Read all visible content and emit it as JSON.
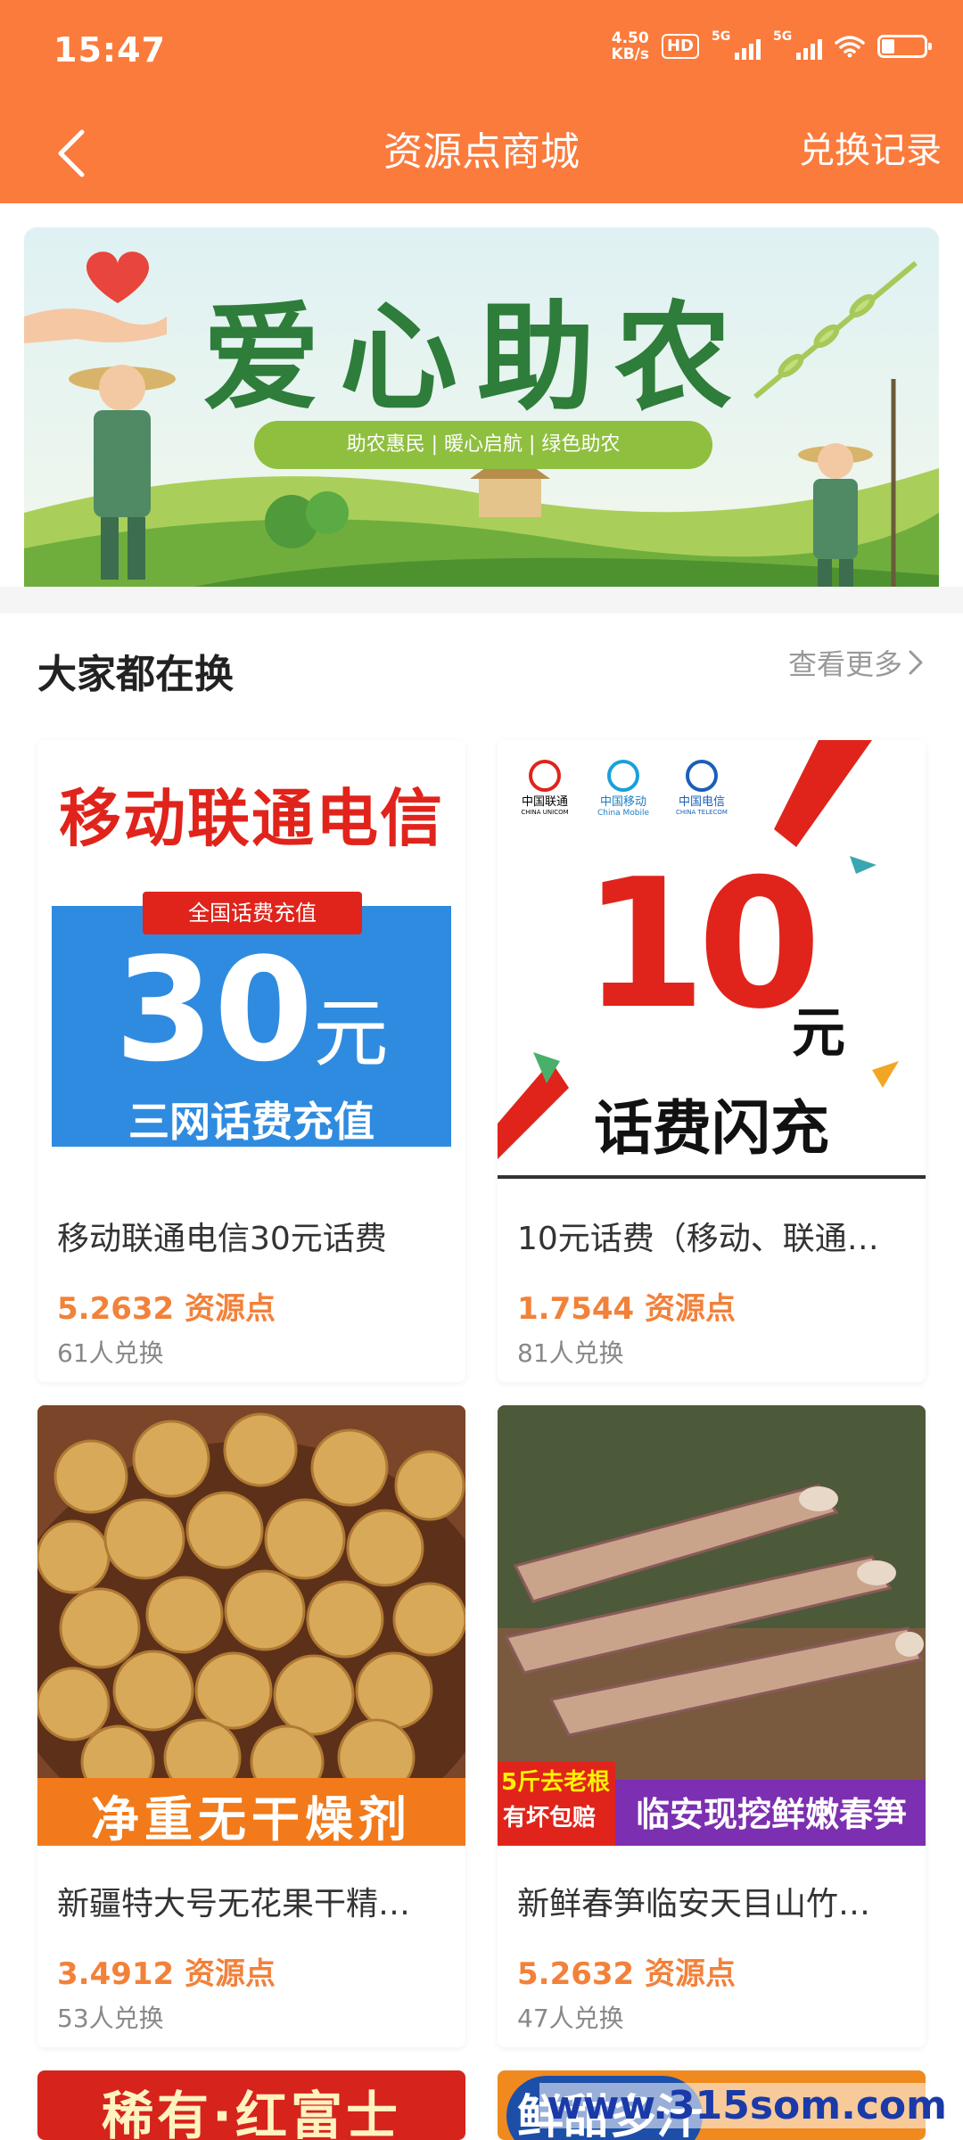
{
  "status_bar": {
    "time": "15:47",
    "net_speed_value": "4.50",
    "net_speed_unit": "KB/s",
    "hd_label": "HD",
    "signal1_label": "5G",
    "signal2_label": "5G"
  },
  "header": {
    "title": "资源点商城",
    "right_link": "兑换记录",
    "background_color": "#fb7b3c"
  },
  "banner": {
    "title": "爱心助农",
    "slogan": "助农惠民 | 暖心启航 | 绿色助农"
  },
  "section": {
    "title": "大家都在换",
    "more_label": "查看更多"
  },
  "products": [
    {
      "name": "移动联通电信30元话费",
      "price": "5.2632 资源点",
      "exchanged": "61人兑换",
      "image": {
        "headline": "移动联通电信",
        "tag": "全国话费充值",
        "amount": "30",
        "unit": "元",
        "subline": "三网话费充值"
      }
    },
    {
      "name": "10元话费（移动、联通…",
      "price": "1.7544 资源点",
      "exchanged": "81人兑换",
      "image": {
        "carrier1": "中国联通",
        "carrier1_en": "CHINA UNICOM",
        "carrier2": "中国移动",
        "carrier2_en": "China Mobile",
        "carrier3": "中国电信",
        "carrier3_en": "CHINA TELECOM",
        "amount": "10",
        "unit": "元",
        "subline": "话费闪充"
      }
    },
    {
      "name": "新疆特大号无花果干精…",
      "price": "3.4912 资源点",
      "exchanged": "53人兑换",
      "image": {
        "caption": "净重无干燥剂"
      }
    },
    {
      "name": "新鲜春笋临安天目山竹…",
      "price": "5.2632 资源点",
      "exchanged": "47人兑换",
      "image": {
        "badge_line1": "5斤去老根",
        "badge_line2": "有坏包赔",
        "caption": "临安现挖鲜嫩春笋"
      }
    },
    {
      "image": {
        "caption": "稀有·红富士"
      }
    },
    {
      "image": {
        "caption": "鲜甜多汁"
      }
    }
  ],
  "watermark": "www.315som.com"
}
